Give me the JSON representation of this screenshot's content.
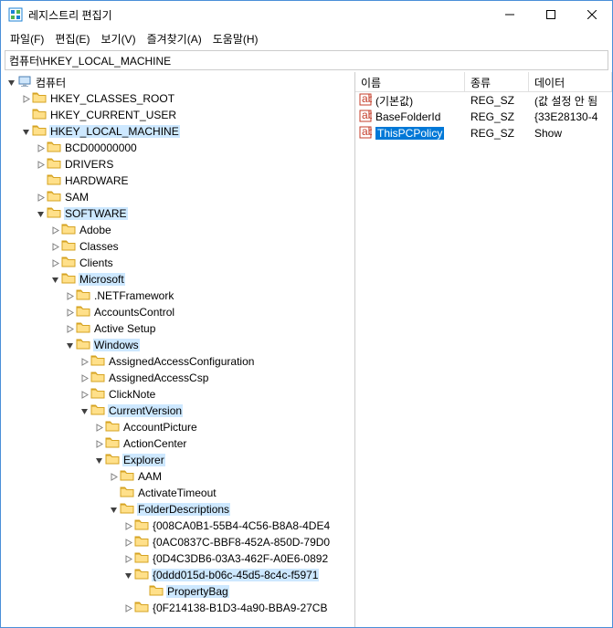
{
  "title": "레지스트리 편집기",
  "menu": {
    "file": "파일(F)",
    "edit": "편집(E)",
    "view": "보기(V)",
    "fav": "즐겨찾기(A)",
    "help": "도움말(H)"
  },
  "address": "컴퓨터\\HKEY_LOCAL_MACHINE",
  "hdr": {
    "name": "이름",
    "type": "종류",
    "data": "데이터"
  },
  "values": [
    {
      "name": "(기본값)",
      "type": "REG_SZ",
      "data": "(값 설정 안 됨",
      "sel": false
    },
    {
      "name": "BaseFolderId",
      "type": "REG_SZ",
      "data": "{33E28130-4",
      "sel": false
    },
    {
      "name": "ThisPCPolicy",
      "type": "REG_SZ",
      "data": "Show",
      "sel": true
    }
  ],
  "tree": [
    {
      "d": 0,
      "exp": "open",
      "icon": "pc",
      "label": "컴퓨터",
      "hl": false
    },
    {
      "d": 1,
      "exp": "closed",
      "icon": "folder",
      "label": "HKEY_CLASSES_ROOT",
      "hl": false
    },
    {
      "d": 1,
      "exp": "none",
      "icon": "folder",
      "label": "HKEY_CURRENT_USER",
      "hl": false
    },
    {
      "d": 1,
      "exp": "open",
      "icon": "folder",
      "label": "HKEY_LOCAL_MACHINE",
      "hl": true
    },
    {
      "d": 2,
      "exp": "closed",
      "icon": "folder",
      "label": "BCD00000000",
      "hl": false
    },
    {
      "d": 2,
      "exp": "closed",
      "icon": "folder",
      "label": "DRIVERS",
      "hl": false
    },
    {
      "d": 2,
      "exp": "none",
      "icon": "folder",
      "label": "HARDWARE",
      "hl": false
    },
    {
      "d": 2,
      "exp": "closed",
      "icon": "folder",
      "label": "SAM",
      "hl": false
    },
    {
      "d": 2,
      "exp": "open",
      "icon": "folder",
      "label": "SOFTWARE",
      "hl": true
    },
    {
      "d": 3,
      "exp": "closed",
      "icon": "folder",
      "label": "Adobe",
      "hl": false
    },
    {
      "d": 3,
      "exp": "closed",
      "icon": "folder",
      "label": "Classes",
      "hl": false
    },
    {
      "d": 3,
      "exp": "closed",
      "icon": "folder",
      "label": "Clients",
      "hl": false
    },
    {
      "d": 3,
      "exp": "open",
      "icon": "folder",
      "label": "Microsoft",
      "hl": true
    },
    {
      "d": 4,
      "exp": "closed",
      "icon": "folder",
      "label": ".NETFramework",
      "hl": false
    },
    {
      "d": 4,
      "exp": "closed",
      "icon": "folder",
      "label": "AccountsControl",
      "hl": false
    },
    {
      "d": 4,
      "exp": "closed",
      "icon": "folder",
      "label": "Active Setup",
      "hl": false
    },
    {
      "d": 4,
      "exp": "open",
      "icon": "folder",
      "label": "Windows",
      "hl": true
    },
    {
      "d": 5,
      "exp": "closed",
      "icon": "folder",
      "label": "AssignedAccessConfiguration",
      "hl": false
    },
    {
      "d": 5,
      "exp": "closed",
      "icon": "folder",
      "label": "AssignedAccessCsp",
      "hl": false
    },
    {
      "d": 5,
      "exp": "closed",
      "icon": "folder",
      "label": "ClickNote",
      "hl": false
    },
    {
      "d": 5,
      "exp": "open",
      "icon": "folder",
      "label": "CurrentVersion",
      "hl": true
    },
    {
      "d": 6,
      "exp": "closed",
      "icon": "folder",
      "label": "AccountPicture",
      "hl": false
    },
    {
      "d": 6,
      "exp": "closed",
      "icon": "folder",
      "label": "ActionCenter",
      "hl": false
    },
    {
      "d": 6,
      "exp": "open",
      "icon": "folder",
      "label": "Explorer",
      "hl": true
    },
    {
      "d": 7,
      "exp": "closed",
      "icon": "folder",
      "label": "AAM",
      "hl": false
    },
    {
      "d": 7,
      "exp": "none",
      "icon": "folder",
      "label": "ActivateTimeout",
      "hl": false
    },
    {
      "d": 7,
      "exp": "open",
      "icon": "folder",
      "label": "FolderDescriptions",
      "hl": true
    },
    {
      "d": 8,
      "exp": "closed",
      "icon": "folder",
      "label": "{008CA0B1-55B4-4C56-B8A8-4DE4",
      "hl": false
    },
    {
      "d": 8,
      "exp": "closed",
      "icon": "folder",
      "label": "{0AC0837C-BBF8-452A-850D-79D0",
      "hl": false
    },
    {
      "d": 8,
      "exp": "closed",
      "icon": "folder",
      "label": "{0D4C3DB6-03A3-462F-A0E6-0892",
      "hl": false
    },
    {
      "d": 8,
      "exp": "open",
      "icon": "folder",
      "label": "{0ddd015d-b06c-45d5-8c4c-f5971",
      "hl": true
    },
    {
      "d": 9,
      "exp": "none",
      "icon": "folder",
      "label": "PropertyBag",
      "hl": true
    },
    {
      "d": 8,
      "exp": "closed",
      "icon": "folder",
      "label": "{0F214138-B1D3-4a90-BBA9-27CB",
      "hl": false
    }
  ]
}
